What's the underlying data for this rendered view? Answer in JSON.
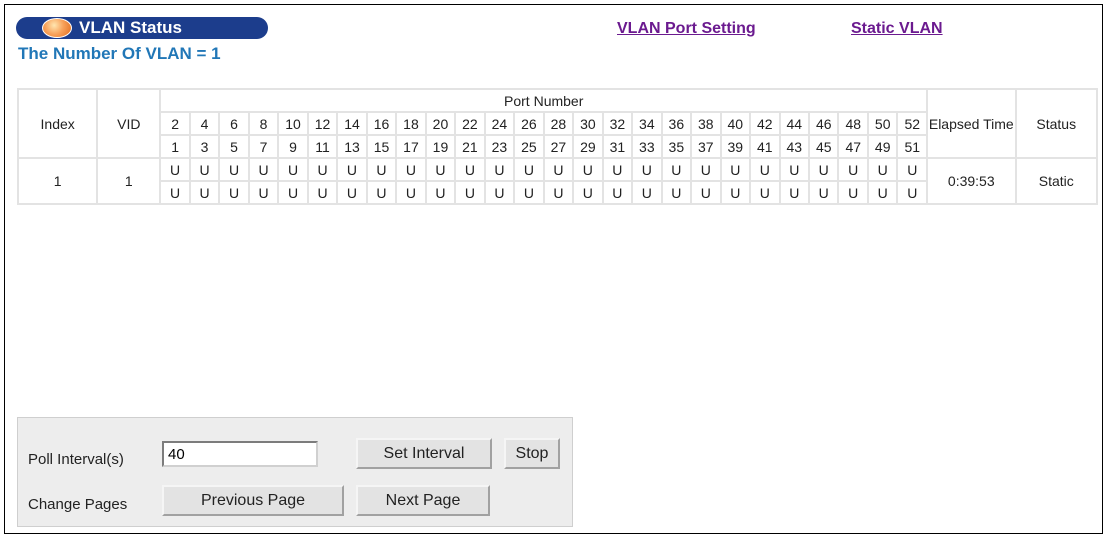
{
  "header": {
    "title": "VLAN Status",
    "vlan_count": "The Number Of VLAN = 1",
    "links": {
      "port_setting": "VLAN Port Setting",
      "static_vlan": "Static VLAN"
    }
  },
  "table": {
    "headers": {
      "index": "Index",
      "vid": "VID",
      "port_number": "Port Number",
      "elapsed_time": "Elapsed Time",
      "status": "Status"
    },
    "ports_even": [
      "2",
      "4",
      "6",
      "8",
      "10",
      "12",
      "14",
      "16",
      "18",
      "20",
      "22",
      "24",
      "26",
      "28",
      "30",
      "32",
      "34",
      "36",
      "38",
      "40",
      "42",
      "44",
      "46",
      "48",
      "50",
      "52"
    ],
    "ports_odd": [
      "1",
      "3",
      "5",
      "7",
      "9",
      "11",
      "13",
      "15",
      "17",
      "19",
      "21",
      "23",
      "25",
      "27",
      "29",
      "31",
      "33",
      "35",
      "37",
      "39",
      "41",
      "43",
      "45",
      "47",
      "49",
      "51"
    ],
    "rows": [
      {
        "index": "1",
        "vid": "1",
        "even_ports": [
          "U",
          "U",
          "U",
          "U",
          "U",
          "U",
          "U",
          "U",
          "U",
          "U",
          "U",
          "U",
          "U",
          "U",
          "U",
          "U",
          "U",
          "U",
          "U",
          "U",
          "U",
          "U",
          "U",
          "U",
          "U",
          "U"
        ],
        "odd_ports": [
          "U",
          "U",
          "U",
          "U",
          "U",
          "U",
          "U",
          "U",
          "U",
          "U",
          "U",
          "U",
          "U",
          "U",
          "U",
          "U",
          "U",
          "U",
          "U",
          "U",
          "U",
          "U",
          "U",
          "U",
          "U",
          "U"
        ],
        "elapsed": "0:39:53",
        "status": "Static"
      }
    ]
  },
  "controls": {
    "poll_label": "Poll Interval(s)",
    "poll_value": "40",
    "set_interval": "Set Interval",
    "stop": "Stop",
    "pages_label": "Change Pages",
    "prev_page": "Previous Page",
    "next_page": "Next Page"
  }
}
